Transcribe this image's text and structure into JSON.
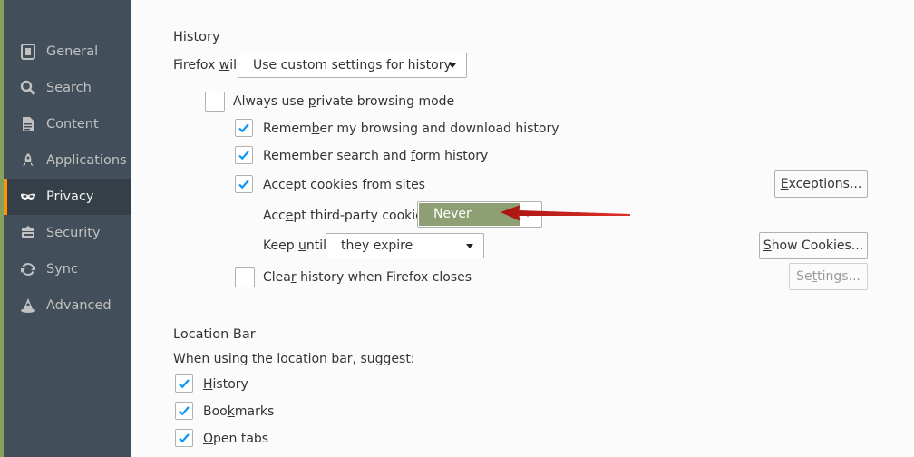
{
  "colors": {
    "sidebar_bg": "#424f5a",
    "selected_bg": "#343f48",
    "accent": "#ff9500",
    "check": "#0996f8",
    "highlight": "#8f9f74",
    "annotation_arrow": "#d0201c"
  },
  "sidebar": {
    "items": [
      {
        "label": "General",
        "icon": "general-icon"
      },
      {
        "label": "Search",
        "icon": "search-icon"
      },
      {
        "label": "Content",
        "icon": "content-icon"
      },
      {
        "label": "Applications",
        "icon": "applications-icon"
      },
      {
        "label": "Privacy",
        "icon": "privacy-mask-icon",
        "selected": true
      },
      {
        "label": "Security",
        "icon": "security-icon"
      },
      {
        "label": "Sync",
        "icon": "sync-icon"
      },
      {
        "label": "Advanced",
        "icon": "advanced-icon"
      }
    ]
  },
  "history": {
    "title": "History",
    "firefox_will_label": "Firefox will:",
    "firefox_will_value": "Use custom settings for history",
    "private_mode": {
      "label": "Always use private browsing mode",
      "checked": false
    },
    "remember_browsing": {
      "label": "Remember my browsing and download history",
      "checked": true
    },
    "remember_search": {
      "label": "Remember search and form history",
      "checked": true
    },
    "accept_cookies": {
      "label": "Accept cookies from sites",
      "checked": true
    },
    "exceptions_button": "Exceptions...",
    "third_party_label": "Accept third-party cookies:",
    "third_party_value": "Never",
    "keep_until_label": "Keep until:",
    "keep_until_value": "they expire",
    "show_cookies_button": "Show Cookies...",
    "clear_history": {
      "label": "Clear history when Firefox closes",
      "checked": false
    },
    "settings_button": "Settings..."
  },
  "location_bar": {
    "title": "Location Bar",
    "suggest_label": "When using the location bar, suggest:",
    "history": {
      "label": "History",
      "checked": true
    },
    "bookmarks": {
      "label": "Bookmarks",
      "checked": true
    },
    "open_tabs": {
      "label": "Open tabs",
      "checked": true
    }
  }
}
